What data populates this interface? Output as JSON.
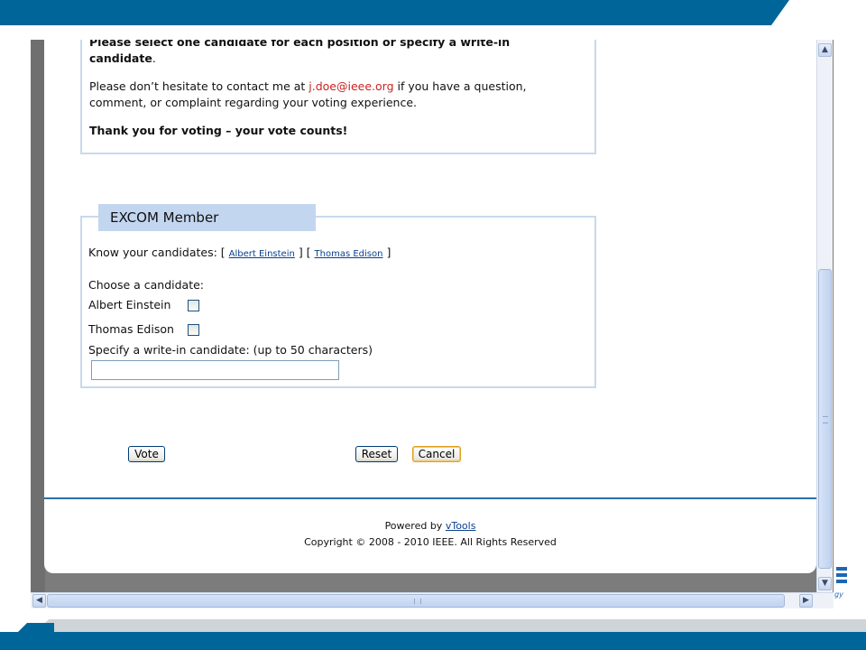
{
  "intro": {
    "cut_line": "Please select one candidate for each position or specify a write-in",
    "cut_line_bold": "candidate",
    "cut_line_end": ".",
    "contact_prefix": "Please don’t hesitate to contact me at ",
    "contact_email": "j.doe@ieee.org",
    "contact_suffix_1": " if you have a question,",
    "contact_line_2": "comment, or complaint regarding your voting experience.",
    "thanks": "Thank you for voting – your vote counts!"
  },
  "excom": {
    "legend": "EXCOM Member",
    "know_label": "Know your candidates: [",
    "sep": "] [",
    "end": "]",
    "links": [
      "Albert Einstein",
      "Thomas Edison"
    ],
    "choose_label": "Choose a candidate:",
    "candidates": [
      {
        "name": "Albert Einstein",
        "checked": false
      },
      {
        "name": "Thomas Edison",
        "checked": false
      }
    ],
    "writein_label": "Specify a write-in candidate: (up to 50 characters)",
    "writein_value": ""
  },
  "buttons": {
    "vote": "Vote",
    "reset": "Reset",
    "cancel": "Cancel"
  },
  "footer": {
    "powered_prefix": "Powered by ",
    "powered_link": "vTools",
    "copyright": "Copyright © 2008 - 2010 IEEE. All Rights Reserved"
  },
  "slide_decor": {
    "logo_letter": "E",
    "logo_text": "gy"
  },
  "scroll_icons": {
    "up": "scroll-up-arrow-icon",
    "down": "scroll-down-arrow-icon",
    "left": "scroll-left-arrow-icon",
    "right": "scroll-right-arrow-icon"
  },
  "colors": {
    "brand_blue": "#006699",
    "legend_bg": "#c3d6f0",
    "box_border": "#c9d9ec",
    "email_red": "#cc2222"
  }
}
